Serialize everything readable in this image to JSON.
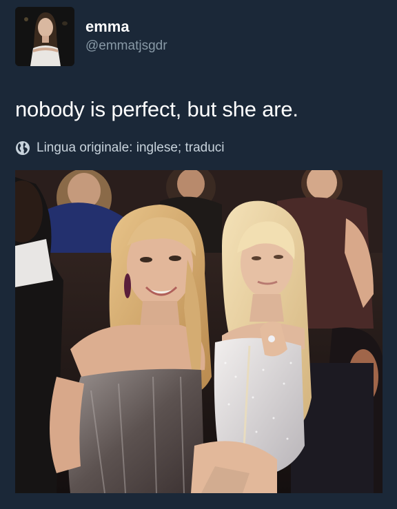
{
  "tweet": {
    "display_name": "emma",
    "handle": "@emmatjsgdr",
    "text": "nobody is perfect, but she are.",
    "translation": {
      "label": "Lingua originale: inglese; traduci",
      "icon": "globe-icon"
    },
    "media": {
      "kind": "photo"
    }
  },
  "colors": {
    "background": "#1b2838",
    "text_primary": "#ffffff",
    "text_secondary": "#8899a6"
  }
}
